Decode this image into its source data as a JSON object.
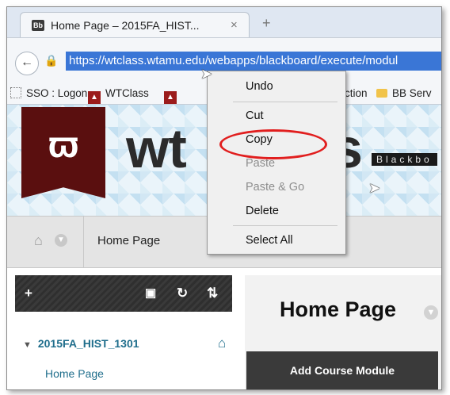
{
  "browser": {
    "tab_favicon": "Bb",
    "tab_title": "Home Page – 2015FA_HIST...",
    "tab_close": "×",
    "new_tab": "+",
    "url": "https://wtclass.wtamu.edu/webapps/blackboard/execute/modul",
    "back_icon": "back-arrow-icon",
    "lock_icon": "lock-icon"
  },
  "bookmarks": [
    {
      "label": "SSO : Logon"
    },
    {
      "label": "WTClass"
    },
    {
      "label": "ction"
    },
    {
      "label": "BB Serv"
    }
  ],
  "banner": {
    "logo_glyph": "ϖ",
    "wordmark_left": "wt",
    "wordmark_right": "s",
    "blackboard_text": "Blackbo"
  },
  "breadcrumb": {
    "label": "Home Page"
  },
  "course_menu": {
    "add": "+",
    "course_name": "2015FA_HIST_1301",
    "home_link": "Home Page"
  },
  "content": {
    "heading": "Home Page",
    "add_module_button": "Add Course Module"
  },
  "context_menu": {
    "items": [
      {
        "label": "Undo",
        "enabled": true
      },
      {
        "label": "Cut",
        "enabled": true
      },
      {
        "label": "Copy",
        "enabled": true,
        "highlighted": true
      },
      {
        "label": "Paste",
        "enabled": false
      },
      {
        "label": "Paste & Go",
        "enabled": false
      },
      {
        "label": "Delete",
        "enabled": true
      },
      {
        "label": "Select All",
        "enabled": true
      }
    ]
  },
  "colors": {
    "url_selection": "#3a76d6",
    "logo_maroon": "#5a0f0f",
    "link_teal": "#1f6e8c",
    "highlight_ring": "#e11e1e"
  }
}
